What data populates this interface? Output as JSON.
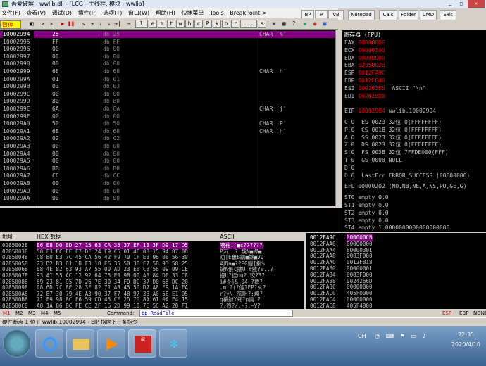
{
  "window": {
    "title": "吾爱破解 - wwlib.dll - [LCG - 主线程, 模块 - wwlib]"
  },
  "menu": [
    "文件(F)",
    "查看(V)",
    "调试(D)",
    "插件(P)",
    "选项(T)",
    "窗口(W)",
    "帮助(H)",
    "快捷菜单",
    "Tools",
    "BreakPoint->"
  ],
  "right_buttons": [
    "BP",
    "P",
    "VB",
    "Notepad",
    "Calc",
    "Folder",
    "CMD",
    "Exit"
  ],
  "toolbar": {
    "status": "暂停",
    "letters": [
      "l",
      "e",
      "m",
      "t",
      "w",
      "h",
      "c",
      "P",
      "k",
      "b",
      "r",
      "...",
      "s"
    ]
  },
  "cpu": {
    "rows": [
      {
        "addr": "10002994",
        "hex": "25",
        "dis": "db 25",
        "cmt": "CHAR '%'",
        "sel": true
      },
      {
        "addr": "10002995",
        "hex": "FF",
        "dis": "db FF",
        "cmt": ""
      },
      {
        "addr": "10002996",
        "hex": "00",
        "dis": "db 00",
        "cmt": ""
      },
      {
        "addr": "10002997",
        "hex": "00",
        "dis": "db 00",
        "cmt": ""
      },
      {
        "addr": "10002998",
        "hex": "00",
        "dis": "db 00",
        "cmt": ""
      },
      {
        "addr": "10002999",
        "hex": "68",
        "dis": "db 68",
        "cmt": "CHAR 'h'"
      },
      {
        "addr": "1000299A",
        "hex": "01",
        "dis": "db 01",
        "cmt": ""
      },
      {
        "addr": "1000299B",
        "hex": "03",
        "dis": "db 03",
        "cmt": ""
      },
      {
        "addr": "1000299C",
        "hex": "00",
        "dis": "db 00",
        "cmt": ""
      },
      {
        "addr": "1000299D",
        "hex": "80",
        "dis": "db 80",
        "cmt": ""
      },
      {
        "addr": "1000299E",
        "hex": "6A",
        "dis": "db 6A",
        "cmt": "CHAR 'j'"
      },
      {
        "addr": "1000299F",
        "hex": "00",
        "dis": "db 00",
        "cmt": ""
      },
      {
        "addr": "100029A0",
        "hex": "50",
        "dis": "db 50",
        "cmt": "CHAR 'P'"
      },
      {
        "addr": "100029A1",
        "hex": "68",
        "dis": "db 68",
        "cmt": "CHAR 'h'"
      },
      {
        "addr": "100029A2",
        "hex": "02",
        "dis": "db 02",
        "cmt": ""
      },
      {
        "addr": "100029A3",
        "hex": "00",
        "dis": "db 00",
        "cmt": ""
      },
      {
        "addr": "100029A4",
        "hex": "00",
        "dis": "db 00",
        "cmt": ""
      },
      {
        "addr": "100029A5",
        "hex": "00",
        "dis": "db 00",
        "cmt": ""
      },
      {
        "addr": "100029A6",
        "hex": "BB",
        "dis": "db BB",
        "cmt": ""
      },
      {
        "addr": "100029A7",
        "hex": "CC",
        "dis": "db CC",
        "cmt": ""
      },
      {
        "addr": "100029A8",
        "hex": "00",
        "dis": "db 00",
        "cmt": ""
      },
      {
        "addr": "100029A9",
        "hex": "00",
        "dis": "db 00",
        "cmt": ""
      },
      {
        "addr": "100029AA",
        "hex": "00",
        "dis": "db 00",
        "cmt": ""
      }
    ]
  },
  "registers": {
    "header": "寄存器 (FPU)",
    "gp": [
      {
        "name": "EAX",
        "value": "00000006",
        "extra": ""
      },
      {
        "name": "ECX",
        "value": "00000100",
        "extra": ""
      },
      {
        "name": "EDX",
        "value": "00000000",
        "extra": ""
      },
      {
        "name": "EBX",
        "value": "02850028",
        "extra": ""
      },
      {
        "name": "ESP",
        "value": "0012FA9C",
        "extra": ""
      },
      {
        "name": "EBP",
        "value": "0012FB40",
        "extra": ""
      },
      {
        "name": "ESI",
        "value": "10026355",
        "extra": "ASCII \"\\n\""
      },
      {
        "name": "EDI",
        "value": "00262800",
        "extra": ""
      }
    ],
    "eip": {
      "name": "EIP",
      "value": "10002994",
      "extra": "wwlib.10002994"
    },
    "flags": [
      "C 0  ES 0023 32位 0(FFFFFFFF)",
      "P 0  CS 001B 32位 0(FFFFFFFF)",
      "A 0  SS 0023 32位 0(FFFFFFFF)",
      "Z 0  DS 0023 32位 0(FFFFFFFF)",
      "S 0  FS 003B 32位 7FFDE000(FFF)",
      "T 0  GS 0000 NULL",
      "D 0",
      "O 0  LastErr ERROR_SUCCESS (00000000)"
    ],
    "efl": "EFL 00000202 (NO,NB,NE,A,NS,PO,GE,G)",
    "fpu": [
      "ST0 empty 0.0",
      "ST1 empty 0.0",
      "ST2 empty 0.0",
      "ST3 empty 0.0",
      "ST4 empty 1.0000000000000000000"
    ]
  },
  "dump": {
    "headers": {
      "addr": "地址",
      "hex": "HEX 数据",
      "ascii": "ASCII"
    },
    "rows": [
      {
        "addr": "02850028",
        "hex": "86 E8 D0 8D 27 15 63 CA 35 37 EF 18 3F D9 17 D5",
        "ascii": "嗬袖.'■c?7????"
      },
      {
        "addr": "02850038",
        "hex": "50 E3 EC FE F7 DF 24 F9 C5 01 4E 0B 15 94 87 0D",
        "ascii": "P沉  ? 魏N■攑■"
      },
      {
        "addr": "02850048",
        "hex": "C8 B0 E3 7C 45 CA 56 42 F9 70 1F E3 96 0B 56 30",
        "ascii": "劝|E蔞B鵳■銝■V0"
      },
      {
        "addr": "02850058",
        "hex": "23 D2 B3 61 1D F3 18 E6 35 50 30 F7 5B 93 58 25",
        "ascii": "#页a■??P0鯷[揦%"
      },
      {
        "addr": "02850068",
        "hex": "E8 4E 82 63 93 A7 55 00 AD 23 EB CB 56 09 09 CE",
        "ascii": "鐽N倀c摟U.#敫?V..?"
      },
      {
        "addr": "02850078",
        "hex": "93 A1 55 AC 12 92 64 75 E0 9B 00 AB 84 DE 33 C8",
        "ascii": "摱U?挃du?.珓?3?"
      },
      {
        "addr": "02850088",
        "hex": "69 23 81 95 7D 26 7E 30 34 FD DC 37 D0 68 DC 20",
        "ascii": "i#仌}&~04 ?裨?"
      },
      {
        "addr": "02850098",
        "hex": "08 6D 7C 8E 28 3F 82 71 A8 45 50 D7 A8 F9 1A FA",
        "ascii": ".m|?(?倆?EP?ㄠ?"
      },
      {
        "addr": "028500A8",
        "hex": "72 B7 30 79 4E A3 90 37 F7 48 97 3B A0 5E E1 05",
        "ascii": "r?yN ?鵍H?;燭?"
      },
      {
        "addr": "028500B8",
        "hex": "71 E9 98 8C F6 59 CD 45 CF 2D 70 8A 61 0A F4 15",
        "ascii": "q樻鏬Y虴?p奱.?"
      },
      {
        "addr": "028500C8",
        "hex": "A0 1A 86 BC FE CE 2F 16 2D 99 10 7E 56 A2 20 F1",
        "ascii": "?.喣?/.-?.~V?"
      }
    ]
  },
  "stack": {
    "rows": [
      {
        "addr": "0012FA9C",
        "value": "000000CB",
        "top": true
      },
      {
        "addr": "0012FAA0",
        "value": "00000000"
      },
      {
        "addr": "0012FAA4",
        "value": "80000301"
      },
      {
        "addr": "0012FAA8",
        "value": "0083F000"
      },
      {
        "addr": "0012FAAC",
        "value": "0012FB18"
      },
      {
        "addr": "0012FAB0",
        "value": "00000001"
      },
      {
        "addr": "0012FAB4",
        "value": "0083F000"
      },
      {
        "addr": "0012FAB8",
        "value": "0024266D"
      },
      {
        "addr": "0012FABC",
        "value": "00000000"
      },
      {
        "addr": "0012FAC0",
        "value": "405F0000"
      },
      {
        "addr": "0012FAC4",
        "value": "00000000"
      },
      {
        "addr": "0012FAC8",
        "value": "405F4000"
      }
    ]
  },
  "cmdbar": {
    "tabs": [
      "M1",
      "M2",
      "M3",
      "M4",
      "M5"
    ],
    "label": "Command:",
    "value": "bp ReadFile",
    "right": [
      "ESP",
      "EBP",
      "NONE"
    ]
  },
  "status": "硬件断点 1 位于 wwlib.10002994 - EIP 指向下一条指令",
  "taskbar": {
    "tray": "CH",
    "time": "22:35",
    "date": "2020/4/10"
  }
}
